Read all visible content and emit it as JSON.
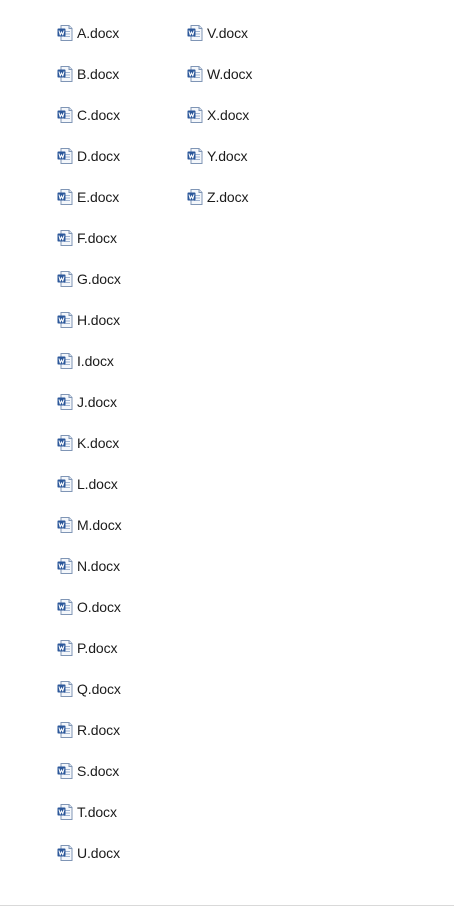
{
  "icon": "word-document-icon",
  "colors": {
    "icon_blue": "#2b579a",
    "icon_light": "#e8eef7",
    "text": "#1b1b1b",
    "divider": "#d9d9d9"
  },
  "columns": [
    {
      "files": [
        "A.docx",
        "B.docx",
        "C.docx",
        "D.docx",
        "E.docx",
        "F.docx",
        "G.docx",
        "H.docx",
        "I.docx",
        "J.docx",
        "K.docx",
        "L.docx",
        "M.docx",
        "N.docx",
        "O.docx",
        "P.docx",
        "Q.docx",
        "R.docx",
        "S.docx",
        "T.docx",
        "U.docx"
      ]
    },
    {
      "files": [
        "V.docx",
        "W.docx",
        "X.docx",
        "Y.docx",
        "Z.docx"
      ]
    }
  ]
}
